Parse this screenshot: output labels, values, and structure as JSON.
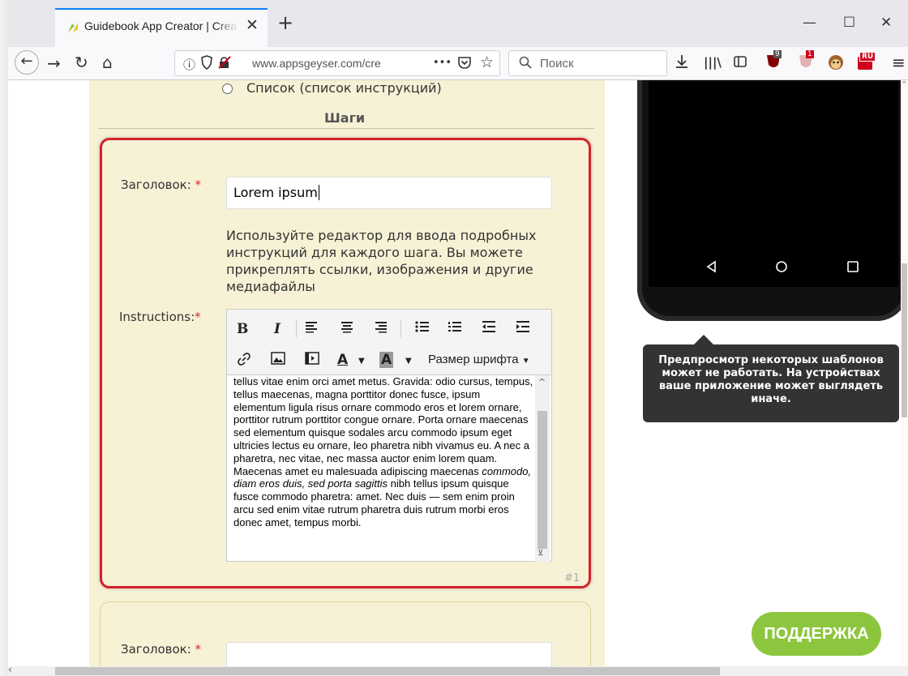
{
  "browser": {
    "tab_title": "Guidebook App Creator | Create",
    "tab_close": "✕",
    "new_tab": "+",
    "window_controls": [
      "—",
      "☐",
      "✕"
    ],
    "url": "www.appsgeyser.com/cre",
    "url_dots": "•••",
    "search_placeholder": "Поиск",
    "badge_counts": [
      "9",
      "1"
    ],
    "badge_ru": "RU"
  },
  "form": {
    "radio_option_label": "Список (список инструкций)",
    "steps_heading": "Шаги",
    "step1": {
      "title_label": "Заголовок:",
      "required_mark": "*",
      "title_value": "Lorem ipsum",
      "help_text": "Используйте редактор для ввода подробных инструкций для каждого шага. Вы можете прикреплять ссылки, изображения и другие медиафайлы",
      "instructions_label": "Instructions:",
      "toolbar": {
        "bold": "B",
        "italic": "I",
        "font_size": "Размер шрифта",
        "font_color": "A",
        "bg_color": "A"
      },
      "body_before_italic": "tellus vitae enim orci amet metus. Gravida: odio cursus, tempus, tellus maecenas, magna porttitor donec fusce, ipsum elementum ligula risus ornare commodo eros et lorem ornare, porttitor rutrum porttitor congue ornare. Porta ornare maecenas sed elementum quisque sodales arcu commodo ipsum eget ultricies lectus eu ornare, leo pharetra nibh vivamus eu. A nec a pharetra, nec vitae, nec massa auctor enim lorem quam. Maecenas amet eu malesuada adipiscing maecenas ",
      "body_italic": "commodo, diam eros duis, sed porta sagittis",
      "body_after_italic": " nibh tellus ipsum quisque fusce commodo pharetra: amet. Nec duis — sem enim proin arcu sed enim vitae rutrum pharetra duis rutrum morbi eros donec amet, tempus morbi.",
      "number": "#1"
    },
    "step2": {
      "title_label": "Заголовок:",
      "required_mark": "*"
    }
  },
  "preview": {
    "tooltip": "Предпросмотр некоторых шаблонов может не работать. На устройствах ваше приложение может выглядеть иначе.",
    "support_button": "ПОДДЕРЖКА"
  },
  "colors": {
    "panel_bg": "#f7f1d5",
    "highlight_border": "#d3232b",
    "support_green": "#8cc63e",
    "tooltip_bg": "#333333"
  }
}
